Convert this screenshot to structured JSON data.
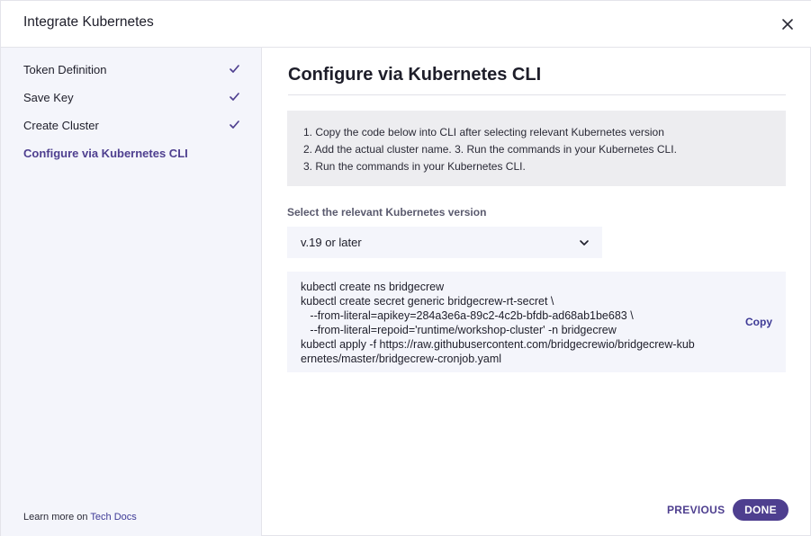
{
  "header": {
    "title": "Integrate Kubernetes",
    "close_icon": "close-icon"
  },
  "sidebar": {
    "steps": [
      {
        "label": "Token Definition",
        "completed": true,
        "active": false
      },
      {
        "label": "Save Key",
        "completed": true,
        "active": false
      },
      {
        "label": "Create Cluster",
        "completed": true,
        "active": false
      },
      {
        "label": "Configure via Kubernetes CLI",
        "completed": false,
        "active": true
      }
    ],
    "learn_more_prefix": "Learn more on",
    "learn_more_link": "Tech Docs"
  },
  "main": {
    "title": "Configure via Kubernetes CLI",
    "instructions": [
      "1. Copy the code below into CLI after selecting relevant Kubernetes version",
      "2. Add the actual cluster name. 3. Run the commands in your Kubernetes CLI.",
      "3. Run the commands in your Kubernetes CLI."
    ],
    "version_label": "Select the relevant Kubernetes version",
    "version_selected": "v.19 or later",
    "code": "kubectl create ns bridgecrew\nkubectl create secret generic bridgecrew-rt-secret \\\n   --from-literal=apikey=284a3e6a-89c2-4c2b-bfdb-ad68ab1be683 \\\n   --from-literal=repoid='runtime/workshop-cluster' -n bridgecrew\nkubectl apply -f https://raw.githubusercontent.com/bridgecrewio/bridgecrew-kub\nernetes/master/bridgecrew-cronjob.yaml",
    "copy_label": "Copy"
  },
  "footer": {
    "previous_label": "PREVIOUS",
    "done_label": "DONE"
  },
  "colors": {
    "accent": "#4e3f8f",
    "link": "#3e3a96",
    "sidebar_bg": "#f4f5fb",
    "instructions_bg": "#ededf0"
  }
}
